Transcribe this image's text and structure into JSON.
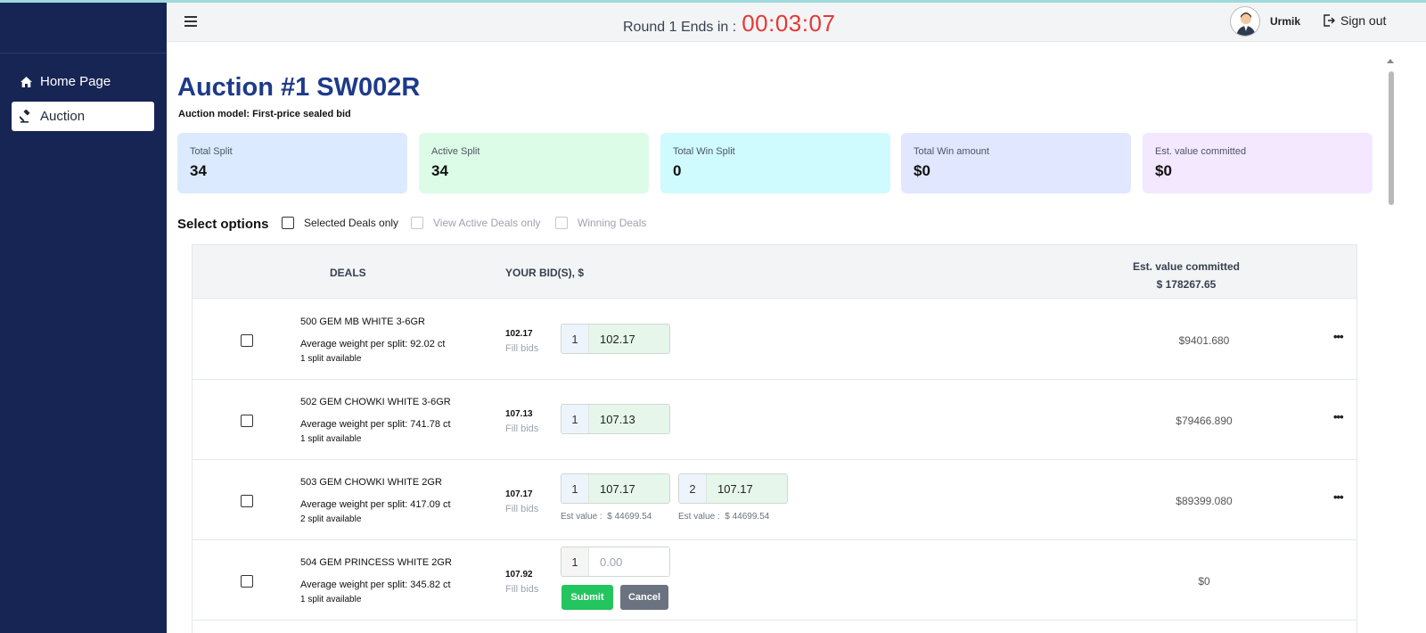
{
  "sidebar": {
    "items": [
      {
        "label": "Home Page",
        "icon": "home-icon"
      },
      {
        "label": "Auction",
        "icon": "gavel-icon"
      }
    ]
  },
  "header": {
    "round_label": "Round 1 Ends in :",
    "timer": "00:03:07",
    "username": "Urmik",
    "signout_label": "Sign out"
  },
  "page": {
    "title": "Auction #1 SW002R",
    "model": "Auction model: First-price sealed bid"
  },
  "stats": [
    {
      "label": "Total Split",
      "value": "34",
      "color": "#dbeafe"
    },
    {
      "label": "Active Split",
      "value": "34",
      "color": "#dcfce7"
    },
    {
      "label": "Total Win Split",
      "value": "0",
      "color": "#cffafe"
    },
    {
      "label": "Total Win amount",
      "value": "$0",
      "color": "#e0e7ff"
    },
    {
      "label": "Est. value committed",
      "value": "$0",
      "color": "#f3e8ff"
    }
  ],
  "options": {
    "label": "Select options",
    "items": [
      {
        "label": "Selected Deals only",
        "enabled": true
      },
      {
        "label": "View Active Deals only",
        "enabled": false
      },
      {
        "label": "Winning Deals",
        "enabled": false
      }
    ]
  },
  "table": {
    "headers": {
      "deals": "DEALS",
      "bids": "YOUR BID(S), $",
      "est_label": "Est. value committed",
      "est_total": "$ 178267.65"
    },
    "fill_label": "Fill bids",
    "est_value_prefix": "Est value :",
    "submit_label": "Submit",
    "cancel_label": "Cancel",
    "rows": [
      {
        "name": "500 GEM MB WHITE 3-6GR",
        "weight": "Average weight per split: 92.02 ct",
        "splits": "1 split available",
        "bid_value": "102.17",
        "bids": [
          {
            "index": "1",
            "amount": "102.17"
          }
        ],
        "value": "$9401.680"
      },
      {
        "name": "502 GEM CHOWKI WHITE 3-6GR",
        "weight": "Average weight per split: 741.78 ct",
        "splits": "1 split available",
        "bid_value": "107.13",
        "bids": [
          {
            "index": "1",
            "amount": "107.13"
          }
        ],
        "value": "$79466.890"
      },
      {
        "name": "503 GEM CHOWKI WHITE 2GR",
        "weight": "Average weight per split: 417.09 ct",
        "splits": "2 split available",
        "bid_value": "107.17",
        "bids": [
          {
            "index": "1",
            "amount": "107.17",
            "est": "$ 44699.54"
          },
          {
            "index": "2",
            "amount": "107.17",
            "est": "$ 44699.54"
          }
        ],
        "value": "$89399.080"
      },
      {
        "name": "504 GEM PRINCESS WHITE 2GR",
        "weight": "Average weight per split: 345.82 ct",
        "splits": "1 split available",
        "bid_value": "107.92",
        "bids": [
          {
            "index": "1",
            "placeholder": "0.00"
          }
        ],
        "value": "$0"
      }
    ]
  }
}
